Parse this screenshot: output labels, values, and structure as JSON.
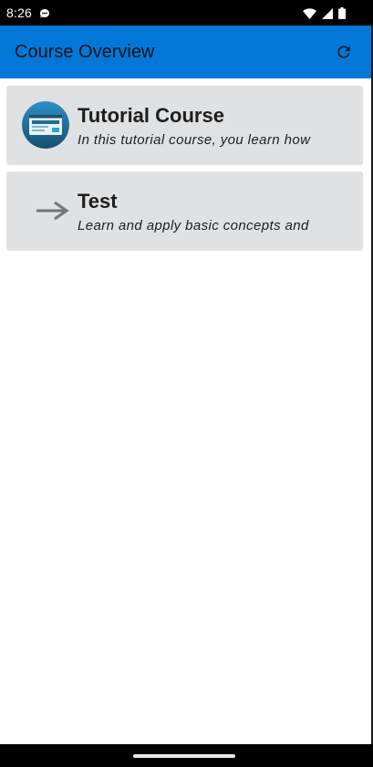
{
  "status_bar": {
    "time": "8:26",
    "icons": [
      "chat-notification-icon",
      "wifi-icon",
      "cellular-signal-icon",
      "battery-icon"
    ]
  },
  "app_bar": {
    "title": "Course Overview",
    "refresh_icon": "refresh-icon",
    "color": "#0277d7"
  },
  "courses": [
    {
      "title": "Tutorial Course",
      "description": "In this tutorial course, you learn how",
      "icon": "tutorial-course-icon"
    },
    {
      "title": "Test",
      "description": "Learn and apply basic concepts and",
      "icon": "arrow-right-icon"
    }
  ],
  "colors": {
    "card_background": "#e0e1e3",
    "status_bar": "#000000",
    "nav_bar": "#000000"
  }
}
